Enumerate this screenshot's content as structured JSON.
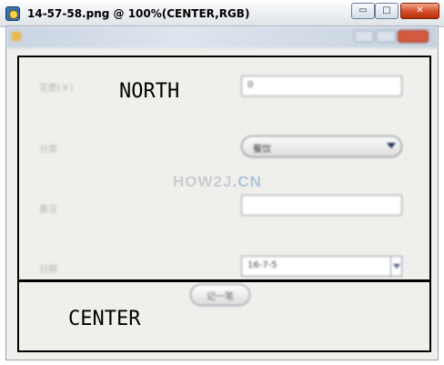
{
  "outer_window": {
    "title": "14-57-58.png @ 100%(CENTER,RGB)",
    "minimize_glyph": "▭",
    "maximize_glyph": "□",
    "close_glyph": "✕"
  },
  "form": {
    "fields": [
      {
        "label": "花费(￥)",
        "value": "0"
      },
      {
        "label": "分类",
        "value": "餐饮"
      },
      {
        "label": "备注",
        "value": ""
      },
      {
        "label": "日期",
        "value": "16-7-5"
      }
    ],
    "record_button_label": "记一笔"
  },
  "overlay": {
    "north_label": "NORTH",
    "center_label": "CENTER"
  },
  "watermark": {
    "main": "HOW2J",
    "accent": ".CN"
  },
  "colors": {
    "close_button": "#d24c27",
    "region_border": "#000000",
    "panel_background": "#f0efec"
  }
}
